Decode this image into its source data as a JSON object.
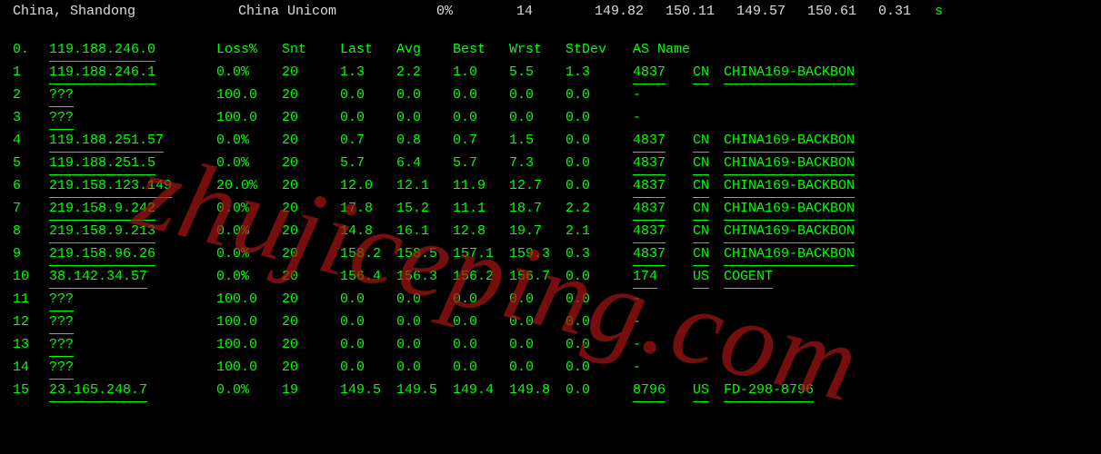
{
  "top": {
    "location": "China, Shandong",
    "isp": "China Unicom",
    "pct": "0%",
    "count": "14",
    "n1": "149.82",
    "n2": "150.11",
    "n3": "149.57",
    "n4": "150.61",
    "n5": "0.31",
    "s": "s"
  },
  "headers": {
    "idx": "0.",
    "host": "119.188.246.0",
    "loss": "Loss%",
    "snt": "Snt",
    "last": "Last",
    "avg": "Avg",
    "best": "Best",
    "wrst": "Wrst",
    "stdev": "StDev",
    "asname": "AS Name"
  },
  "hops": [
    {
      "idx": "1",
      "host": "119.188.246.1",
      "loss": "0.0%",
      "snt": "20",
      "last": "1.3",
      "avg": "2.2",
      "best": "1.0",
      "wrst": "5.5",
      "stdev": "1.3",
      "asn": "4837",
      "cc": "CN",
      "asname": "CHINA169-BACKBON"
    },
    {
      "idx": "2",
      "host": "???",
      "loss": "100.0",
      "snt": "20",
      "last": "0.0",
      "avg": "0.0",
      "best": "0.0",
      "wrst": "0.0",
      "stdev": "0.0",
      "asn": "-",
      "cc": "",
      "asname": ""
    },
    {
      "idx": "3",
      "host": "???",
      "loss": "100.0",
      "snt": "20",
      "last": "0.0",
      "avg": "0.0",
      "best": "0.0",
      "wrst": "0.0",
      "stdev": "0.0",
      "asn": "-",
      "cc": "",
      "asname": ""
    },
    {
      "idx": "4",
      "host": "119.188.251.57",
      "loss": "0.0%",
      "snt": "20",
      "last": "0.7",
      "avg": "0.8",
      "best": "0.7",
      "wrst": "1.5",
      "stdev": "0.0",
      "asn": "4837",
      "cc": "CN",
      "asname": "CHINA169-BACKBON"
    },
    {
      "idx": "5",
      "host": "119.188.251.5",
      "loss": "0.0%",
      "snt": "20",
      "last": "5.7",
      "avg": "6.4",
      "best": "5.7",
      "wrst": "7.3",
      "stdev": "0.0",
      "asn": "4837",
      "cc": "CN",
      "asname": "CHINA169-BACKBON"
    },
    {
      "idx": "6",
      "host": "219.158.123.149",
      "loss": "20.0%",
      "snt": "20",
      "last": "12.0",
      "avg": "12.1",
      "best": "11.9",
      "wrst": "12.7",
      "stdev": "0.0",
      "asn": "4837",
      "cc": "CN",
      "asname": "CHINA169-BACKBON"
    },
    {
      "idx": "7",
      "host": "219.158.9.242",
      "loss": "0.0%",
      "snt": "20",
      "last": "17.8",
      "avg": "15.2",
      "best": "11.1",
      "wrst": "18.7",
      "stdev": "2.2",
      "asn": "4837",
      "cc": "CN",
      "asname": "CHINA169-BACKBON"
    },
    {
      "idx": "8",
      "host": "219.158.9.213",
      "loss": "0.0%",
      "snt": "20",
      "last": "14.8",
      "avg": "16.1",
      "best": "12.8",
      "wrst": "19.7",
      "stdev": "2.1",
      "asn": "4837",
      "cc": "CN",
      "asname": "CHINA169-BACKBON"
    },
    {
      "idx": "9",
      "host": "219.158.96.26",
      "loss": "0.0%",
      "snt": "20",
      "last": "158.2",
      "avg": "158.5",
      "best": "157.1",
      "wrst": "159.3",
      "stdev": "0.3",
      "asn": "4837",
      "cc": "CN",
      "asname": "CHINA169-BACKBON"
    },
    {
      "idx": "10",
      "host": "38.142.34.57",
      "loss": "0.0%",
      "snt": "20",
      "last": "156.4",
      "avg": "156.3",
      "best": "156.2",
      "wrst": "156.7",
      "stdev": "0.0",
      "asn": "174",
      "cc": "US",
      "asname": "COGENT"
    },
    {
      "idx": "11",
      "host": "???",
      "loss": "100.0",
      "snt": "20",
      "last": "0.0",
      "avg": "0.0",
      "best": "0.0",
      "wrst": "0.0",
      "stdev": "0.0",
      "asn": "-",
      "cc": "",
      "asname": ""
    },
    {
      "idx": "12",
      "host": "???",
      "loss": "100.0",
      "snt": "20",
      "last": "0.0",
      "avg": "0.0",
      "best": "0.0",
      "wrst": "0.0",
      "stdev": "0.0",
      "asn": "-",
      "cc": "",
      "asname": ""
    },
    {
      "idx": "13",
      "host": "???",
      "loss": "100.0",
      "snt": "20",
      "last": "0.0",
      "avg": "0.0",
      "best": "0.0",
      "wrst": "0.0",
      "stdev": "0.0",
      "asn": "-",
      "cc": "",
      "asname": ""
    },
    {
      "idx": "14",
      "host": "???",
      "loss": "100.0",
      "snt": "20",
      "last": "0.0",
      "avg": "0.0",
      "best": "0.0",
      "wrst": "0.0",
      "stdev": "0.0",
      "asn": "-",
      "cc": "",
      "asname": ""
    },
    {
      "idx": "15",
      "host": "23.165.248.7",
      "loss": "0.0%",
      "snt": "19",
      "last": "149.5",
      "avg": "149.5",
      "best": "149.4",
      "wrst": "149.8",
      "stdev": "0.0",
      "asn": "8796",
      "cc": "US",
      "asname": "FD-298-8796"
    }
  ],
  "watermark": "zhujiceping.com"
}
